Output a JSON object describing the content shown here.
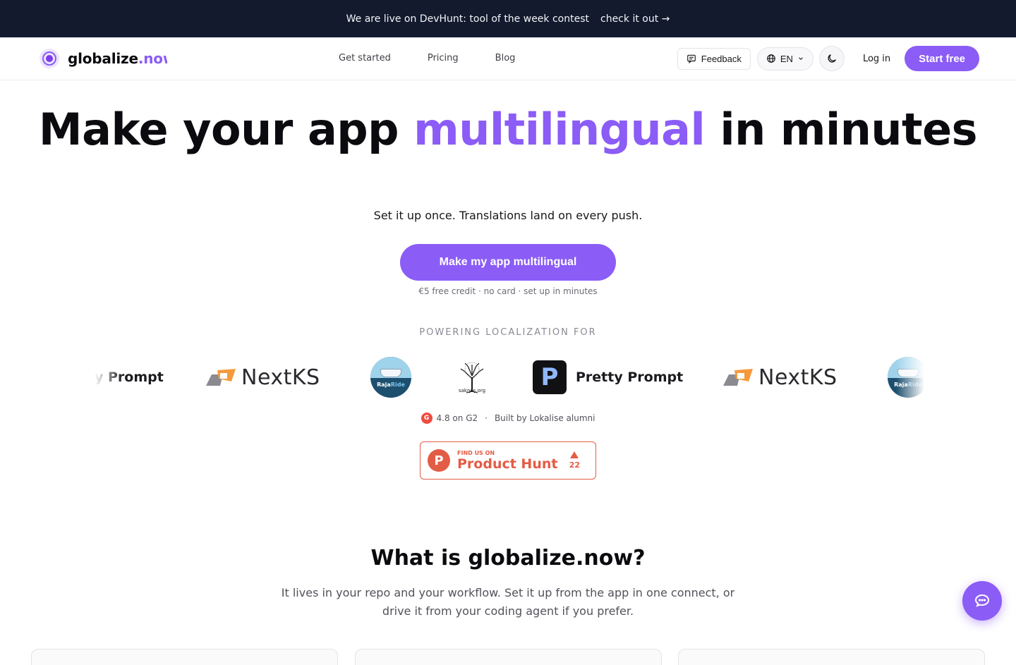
{
  "announcement": {
    "text": "We are live on DevHunt: tool of the week contest",
    "link": "check it out →"
  },
  "brand": {
    "name": "globalize",
    "suffix": ".now"
  },
  "nav": {
    "links": [
      "Get started",
      "Pricing",
      "Blog"
    ],
    "feedback": "Feedback",
    "language": "EN",
    "login": "Log in",
    "start": "Start free"
  },
  "hero": {
    "title_pre": "Make your app ",
    "title_accent": "multilingual",
    "title_post": " in minutes",
    "subtitle": "Set it up once. Translations land on every push.",
    "cta": "Make my app multilingual",
    "note": "€5 free credit · no card · set up in minutes"
  },
  "powering": "POWERING LOCALIZATION FOR",
  "logos": {
    "pretty_prompt": "Pretty Prompt",
    "pretty_prompt_partial": "y Prompt",
    "nextks": "NextKS",
    "rajaride_a": "Raja",
    "rajaride_b": "Ride",
    "saknes": "saknes.org"
  },
  "rating": {
    "g2": "4.8 on G2",
    "sep": "·",
    "alumni": "Built by Lokalise alumni"
  },
  "producthunt": {
    "small": "FIND US ON",
    "big": "Product Hunt",
    "votes": "22"
  },
  "what": {
    "title": "What is globalize.now?",
    "subtitle": "It lives in your repo and your workflow. Set it up from the app in one connect, or drive it from your coding agent if you prefer."
  },
  "colors": {
    "accent": "#8b5cf6",
    "banner": "#131a2e",
    "producthunt": "#e35c45"
  }
}
